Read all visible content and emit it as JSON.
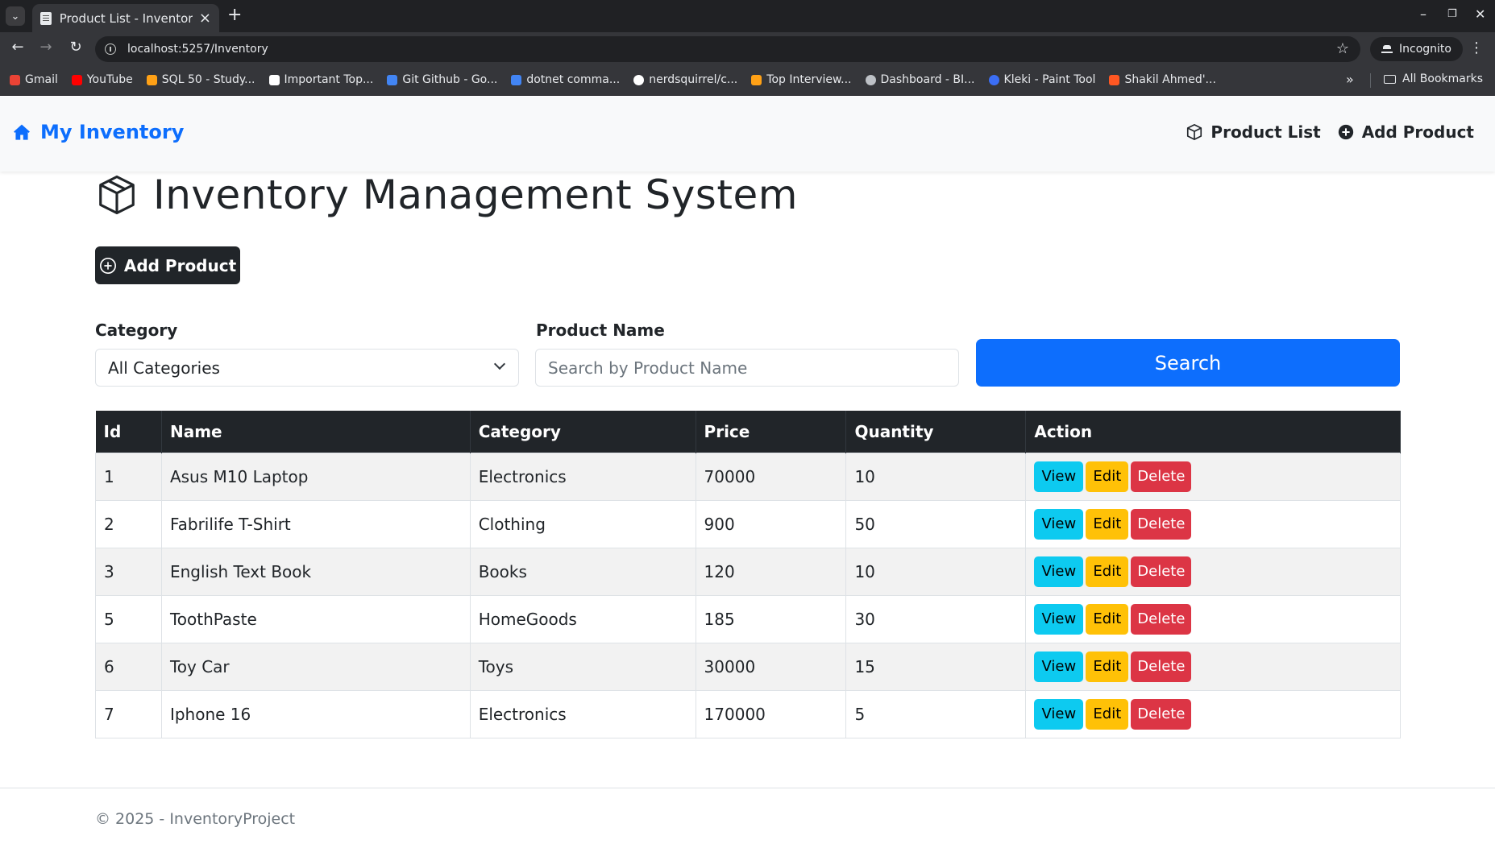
{
  "browser": {
    "tab_title": "Product List - Inventory Project",
    "url": "localhost:5257/Inventory",
    "incognito_label": "Incognito",
    "bookmarks": [
      {
        "label": "Gmail",
        "color": "#ea4335"
      },
      {
        "label": "YouTube",
        "color": "#ff0000"
      },
      {
        "label": "SQL 50 - Study...",
        "color": "#ffa116"
      },
      {
        "label": "Important Top...",
        "color": "#ffffff"
      },
      {
        "label": "Git Github - Go...",
        "color": "#4285f4"
      },
      {
        "label": "dotnet comma...",
        "color": "#4285f4"
      },
      {
        "label": "nerdsquirrel/c...",
        "color": "#ffffff"
      },
      {
        "label": "Top Interview...",
        "color": "#ffa116"
      },
      {
        "label": "Dashboard - BI...",
        "color": "#bdc1c6"
      },
      {
        "label": "Kleki - Paint Tool",
        "color": "#3b6ef5"
      },
      {
        "label": "Shakil Ahmed'...",
        "color": "#ff5722"
      }
    ],
    "all_bookmarks_label": "All Bookmarks"
  },
  "navbar": {
    "brand": "My Inventory",
    "links": [
      "Product List",
      "Add Product"
    ]
  },
  "page": {
    "title": "Inventory Management System",
    "add_button_label": "Add Product"
  },
  "filters": {
    "category_label": "Category",
    "category_selected": "All Categories",
    "product_name_label": "Product Name",
    "product_name_placeholder": "Search by Product Name",
    "search_button_label": "Search"
  },
  "table": {
    "headers": [
      "Id",
      "Name",
      "Category",
      "Price",
      "Quantity",
      "Action"
    ],
    "rows": [
      {
        "id": "1",
        "name": "Asus M10 Laptop",
        "category": "Electronics",
        "price": "70000",
        "quantity": "10"
      },
      {
        "id": "2",
        "name": "Fabrilife T-Shirt",
        "category": "Clothing",
        "price": "900",
        "quantity": "50"
      },
      {
        "id": "3",
        "name": "English Text Book",
        "category": "Books",
        "price": "120",
        "quantity": "10"
      },
      {
        "id": "5",
        "name": "ToothPaste",
        "category": "HomeGoods",
        "price": "185",
        "quantity": "30"
      },
      {
        "id": "6",
        "name": "Toy Car",
        "category": "Toys",
        "price": "30000",
        "quantity": "15"
      },
      {
        "id": "7",
        "name": "Iphone 16",
        "category": "Electronics",
        "price": "170000",
        "quantity": "5"
      }
    ],
    "actions": {
      "view": "View",
      "edit": "Edit",
      "delete": "Delete"
    }
  },
  "footer": {
    "text": "© 2025 - InventoryProject"
  }
}
